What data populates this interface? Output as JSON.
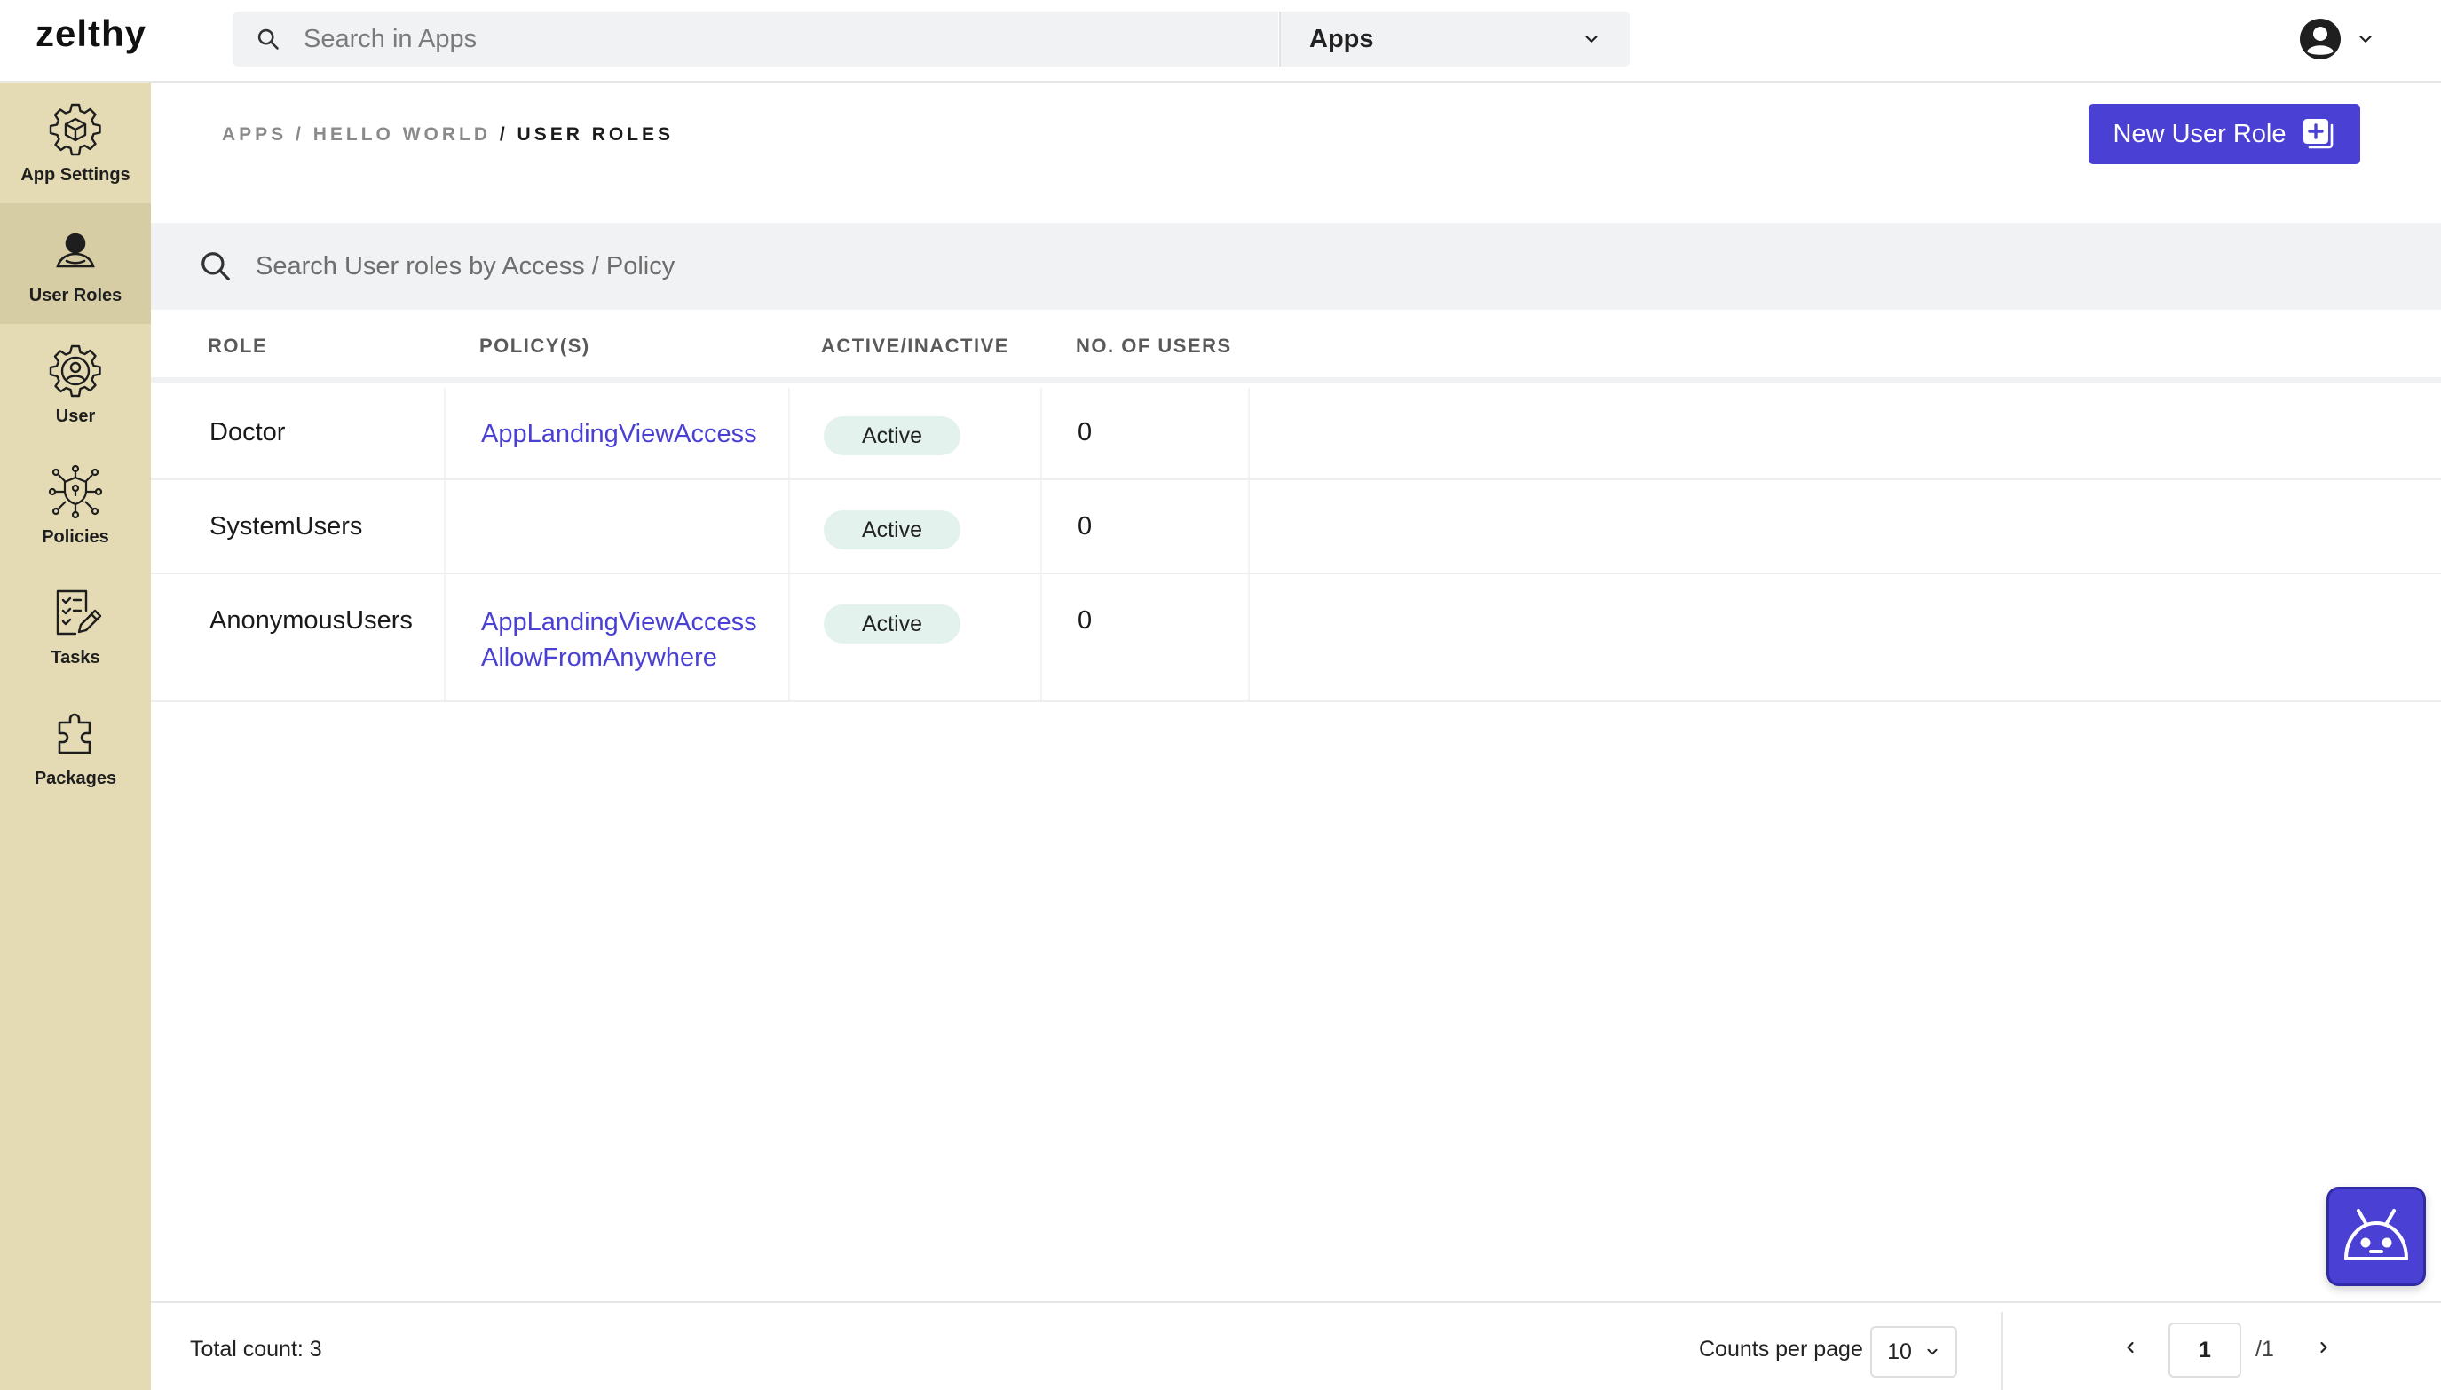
{
  "app": {
    "logo": "zelthy"
  },
  "header": {
    "search_placeholder": "Search in Apps",
    "apps_select_value": "Apps"
  },
  "sidebar": {
    "items": [
      {
        "label": "App Settings",
        "icon": "gear-cube-icon",
        "active": false
      },
      {
        "label": "User Roles",
        "icon": "user-role-icon",
        "active": true
      },
      {
        "label": "User",
        "icon": "user-gear-icon",
        "active": false
      },
      {
        "label": "Policies",
        "icon": "policy-network-icon",
        "active": false
      },
      {
        "label": "Tasks",
        "icon": "task-list-icon",
        "active": false
      },
      {
        "label": "Packages",
        "icon": "puzzle-icon",
        "active": false
      }
    ]
  },
  "breadcrumb": {
    "apps": "APPS",
    "sep1": " / ",
    "app_name": "HELLO WORLD",
    "sep2": " / ",
    "current": "USER ROLES"
  },
  "actions": {
    "new_user_role_label": "New User Role"
  },
  "table": {
    "search_placeholder": "Search User roles by Access / Policy",
    "columns": {
      "role": "ROLE",
      "policies": "POLICY(S)",
      "status": "ACTIVE/INACTIVE",
      "users": "NO. OF USERS"
    },
    "rows": [
      {
        "role": "Doctor",
        "policies": [
          "AppLandingViewAccess"
        ],
        "status": "Active",
        "users": "0"
      },
      {
        "role": "SystemUsers",
        "policies": [],
        "status": "Active",
        "users": "0"
      },
      {
        "role": "AnonymousUsers",
        "policies": [
          "AppLandingViewAccess",
          "AllowFromAnywhere"
        ],
        "status": "Active",
        "users": "0"
      }
    ]
  },
  "footer": {
    "total_count": "Total count: 3",
    "counts_per_page_label": "Counts per page",
    "counts_per_page_value": "10",
    "page_current": "1",
    "page_total": "/1"
  },
  "colors": {
    "accent": "#4a40d4",
    "sidebar_bg": "#e4dbb4",
    "sidebar_active": "#d6cda4",
    "badge_bg": "#e3f2ed"
  }
}
